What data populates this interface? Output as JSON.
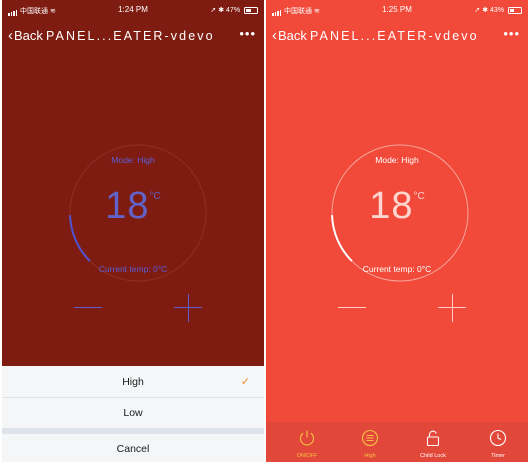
{
  "colors": {
    "left_background": "#7e1c12",
    "right_background": "#f14a3a",
    "left_text": "#5a5ed6",
    "check_accent": "#f08a24",
    "tab_active": "#f5c242"
  },
  "left": {
    "status": {
      "carrier": "中国联通",
      "time": "1:24 PM",
      "battery": "47%",
      "battery_level": 0.47
    },
    "nav": {
      "back_label": "Back",
      "title": "PANEL...EATER-vdevo",
      "more_label": "•••"
    },
    "dial": {
      "mode_label": "Mode: High",
      "temperature": "18",
      "unit": "°C",
      "current_temp_label": "Current temp: 0°C",
      "arc_level": 0.12
    },
    "sheet": {
      "options": [
        {
          "label": "High",
          "selected": true
        },
        {
          "label": "Low",
          "selected": false
        }
      ],
      "check_mark": "✓",
      "cancel_label": "Cancel"
    }
  },
  "right": {
    "status": {
      "carrier": "中国联通",
      "time": "1:25 PM",
      "battery": "43%",
      "battery_level": 0.43
    },
    "nav": {
      "back_label": "Back",
      "title": "PANEL...EATER-vdevo",
      "more_label": "•••"
    },
    "dial": {
      "mode_label": "Mode: High",
      "temperature": "18",
      "unit": "°C",
      "current_temp_label": "Current temp: 0°C",
      "arc_level": 0.12
    },
    "tabs": [
      {
        "label": "ON/OFF",
        "icon": "power-icon",
        "active": true
      },
      {
        "label": "High",
        "icon": "mode-list-icon",
        "active": true
      },
      {
        "label": "Child Lock",
        "icon": "lock-icon",
        "active": false
      },
      {
        "label": "Timer",
        "icon": "clock-icon",
        "active": false
      }
    ]
  }
}
